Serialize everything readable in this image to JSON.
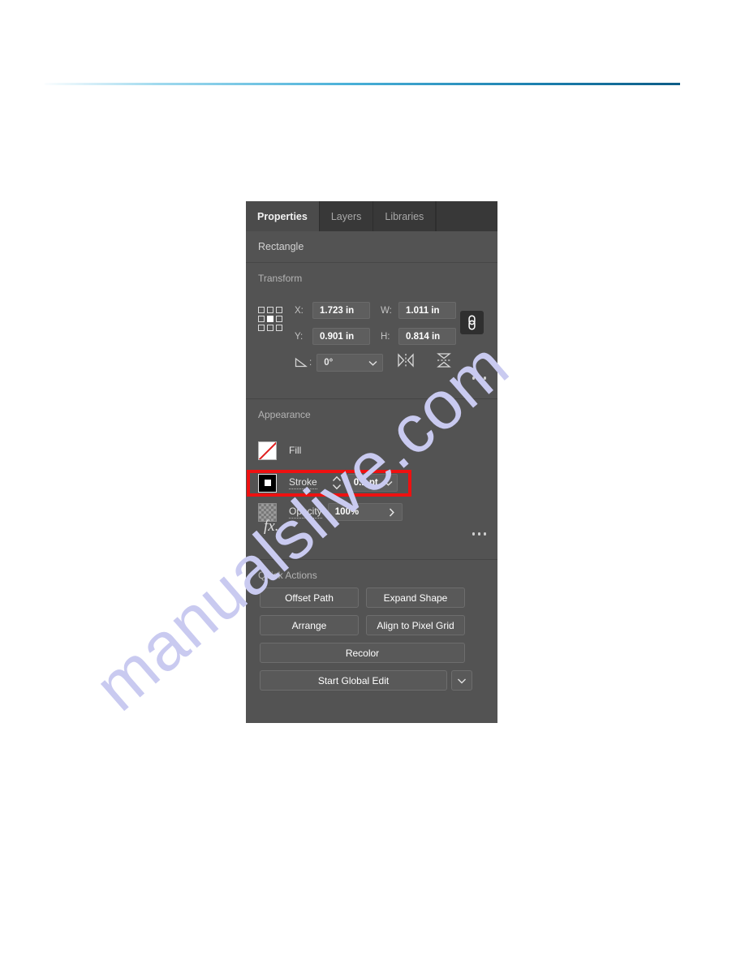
{
  "panel": {
    "tabs": [
      {
        "label": "Properties",
        "active": true
      },
      {
        "label": "Layers",
        "active": false
      },
      {
        "label": "Libraries",
        "active": false
      }
    ],
    "object_type": "Rectangle",
    "transform": {
      "title": "Transform",
      "x_label": "X:",
      "x_value": "1.723 in",
      "y_label": "Y:",
      "y_value": "0.901 in",
      "w_label": "W:",
      "w_value": "1.011 in",
      "h_label": "H:",
      "h_value": "0.814 in",
      "angle_value": "0°",
      "link_icon": "chain-link-icon",
      "reference_point_icon": "reference-point-grid-icon",
      "angle_icon": "rotate-angle-icon",
      "flip_horizontal_icon": "flip-horizontal-icon",
      "flip_vertical_icon": "flip-vertical-icon",
      "more_icon": "more-options-icon"
    },
    "appearance": {
      "title": "Appearance",
      "fill_label": "Fill",
      "fill_swatch_icon": "no-fill-swatch-icon",
      "stroke_label": "Stroke",
      "stroke_swatch_icon": "stroke-swatch-icon",
      "stroke_width_value": "0.1 pt",
      "stroke_stepper_icon": "stepper-up-down-icon",
      "stroke_caret_icon": "chevron-down-icon",
      "opacity_label": "Opacity",
      "opacity_swatch_icon": "checkerboard-swatch-icon",
      "opacity_value": "100%",
      "opacity_arrow_icon": "chevron-right-icon",
      "effects_icon": "fx-effects-icon",
      "effects_label": "fx.",
      "more_icon": "more-options-icon"
    },
    "quick_actions": {
      "title": "Quick Actions",
      "buttons": [
        {
          "label": "Offset Path",
          "size": "half"
        },
        {
          "label": "Expand Shape",
          "size": "half"
        },
        {
          "label": "Arrange",
          "size": "half"
        },
        {
          "label": "Align to Pixel Grid",
          "size": "half"
        },
        {
          "label": "Recolor",
          "size": "full"
        }
      ],
      "global_edit_label": "Start Global Edit",
      "global_edit_caret_icon": "chevron-down-icon"
    }
  },
  "annotation": {
    "highlight_color": "#ee1111",
    "highlight_target": "stroke-row"
  },
  "watermark": {
    "text": "manualslive.com",
    "color": "#c9caf0"
  },
  "header": {
    "rule_color_start": "#9fd9ee",
    "rule_color_end": "#0d5c86"
  }
}
